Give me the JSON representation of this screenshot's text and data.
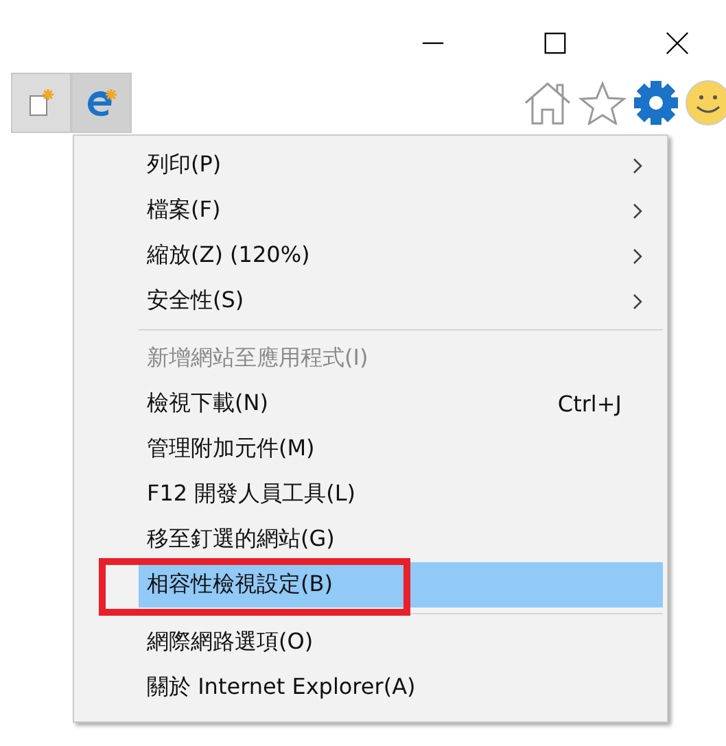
{
  "window_controls": [
    {
      "kind": "minimize"
    },
    {
      "kind": "maximize"
    },
    {
      "kind": "close"
    }
  ],
  "tabs": [
    {
      "kind": "new-tab",
      "selected": false
    },
    {
      "kind": "browser-tab",
      "selected": true
    }
  ],
  "toolbar": [
    {
      "kind": "home"
    },
    {
      "kind": "favorites"
    },
    {
      "kind": "settings"
    },
    {
      "kind": "feedback"
    }
  ],
  "menu": [
    {
      "kind": "item",
      "label": "列印(P)",
      "submenu": true,
      "disabled": false,
      "selected": false,
      "annotated": false
    },
    {
      "kind": "item",
      "label": "檔案(F)",
      "submenu": true,
      "disabled": false,
      "selected": false,
      "annotated": false
    },
    {
      "kind": "item",
      "label": "縮放(Z) (120%)",
      "submenu": true,
      "disabled": false,
      "selected": false,
      "annotated": false
    },
    {
      "kind": "item",
      "label": "安全性(S)",
      "submenu": true,
      "disabled": false,
      "selected": false,
      "annotated": false
    },
    {
      "kind": "separator"
    },
    {
      "kind": "item",
      "label": "新增網站至應用程式(I)",
      "submenu": false,
      "disabled": true,
      "selected": false,
      "annotated": false
    },
    {
      "kind": "item",
      "label": "檢視下載(N)",
      "shortcut": "Ctrl+J",
      "submenu": false,
      "disabled": false,
      "selected": false,
      "annotated": false
    },
    {
      "kind": "item",
      "label": "管理附加元件(M)",
      "submenu": false,
      "disabled": false,
      "selected": false,
      "annotated": false
    },
    {
      "kind": "item",
      "label": "F12 開發人員工具(L)",
      "submenu": false,
      "disabled": false,
      "selected": false,
      "annotated": false
    },
    {
      "kind": "item",
      "label": "移至釘選的網站(G)",
      "submenu": false,
      "disabled": false,
      "selected": false,
      "annotated": false
    },
    {
      "kind": "item",
      "label": "相容性檢視設定(B)",
      "submenu": false,
      "disabled": false,
      "selected": true,
      "annotated": true
    },
    {
      "kind": "separator"
    },
    {
      "kind": "item",
      "label": "網際網路選項(O)",
      "submenu": false,
      "disabled": false,
      "selected": false,
      "annotated": false
    },
    {
      "kind": "item",
      "label": "關於 Internet Explorer(A)",
      "submenu": false,
      "disabled": false,
      "selected": false,
      "annotated": false
    }
  ]
}
